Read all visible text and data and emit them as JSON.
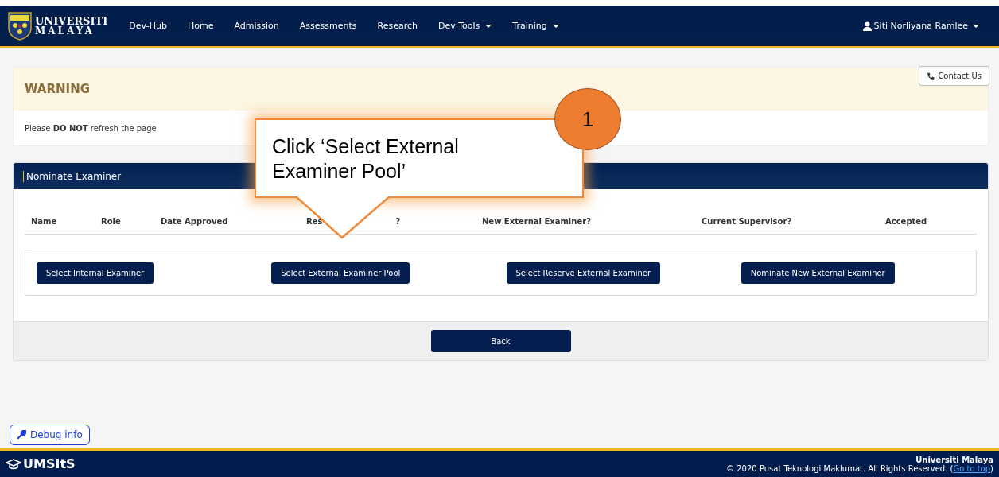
{
  "navbar": {
    "logo_line1": "UNIVERSITI",
    "logo_line2": "MALAYA",
    "items": [
      {
        "label": "Dev-Hub",
        "dropdown": false
      },
      {
        "label": "Home",
        "dropdown": false
      },
      {
        "label": "Admission",
        "dropdown": false
      },
      {
        "label": "Assessments",
        "dropdown": false
      },
      {
        "label": "Research",
        "dropdown": false
      },
      {
        "label": "Dev Tools",
        "dropdown": true
      },
      {
        "label": "Training",
        "dropdown": true
      }
    ],
    "user": "Siti Norliyana Ramlee"
  },
  "contact_button": "Contact Us",
  "warning": {
    "title": "WARNING",
    "message": "Please **DO NOT** refresh the page"
  },
  "panel": {
    "title": "Nominate Examiner",
    "columns": [
      {
        "label": "Name"
      },
      {
        "label": "Role"
      },
      {
        "label": "Date Approved"
      },
      {
        "label": "Res",
        "label_end": "?"
      },
      {
        "label": "New External Examiner?"
      },
      {
        "label": "Current Supervisor?"
      },
      {
        "label": "Accepted"
      }
    ],
    "actions": [
      "Select Internal Examiner",
      "Select External Examiner Pool",
      "Select Reserve External Examiner",
      "Nominate New External Examiner"
    ],
    "back_button": "Back"
  },
  "callout": {
    "text": "Click ‘Select External Examiner Pool’",
    "step": "1"
  },
  "debug_button": "Debug info",
  "footer": {
    "brand": "UMSItS",
    "org": "Universiti Malaya",
    "copyright": "© 2020 Pusat Teknologi Maklumat. All Rights Reserved. (",
    "link": "Go to top",
    "copyright_end": ")"
  }
}
